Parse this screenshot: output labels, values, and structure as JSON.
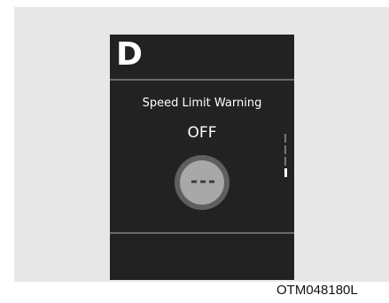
{
  "display": {
    "gear": "D",
    "title": "Speed Limit Warning",
    "status": "OFF",
    "speed_value": "---",
    "scroll_indicator": {
      "segments": 4,
      "active_index": 3
    }
  },
  "figure_code": "OTM048180L",
  "colors": {
    "frame_background": "#e7e7e7",
    "screen_background": "#222222",
    "dial_ring": "#5f5f5f",
    "dial_face": "#a8a8a8",
    "text": "#ffffff"
  },
  "icons": {
    "speed_dial": "speed-limit-dial-icon"
  }
}
